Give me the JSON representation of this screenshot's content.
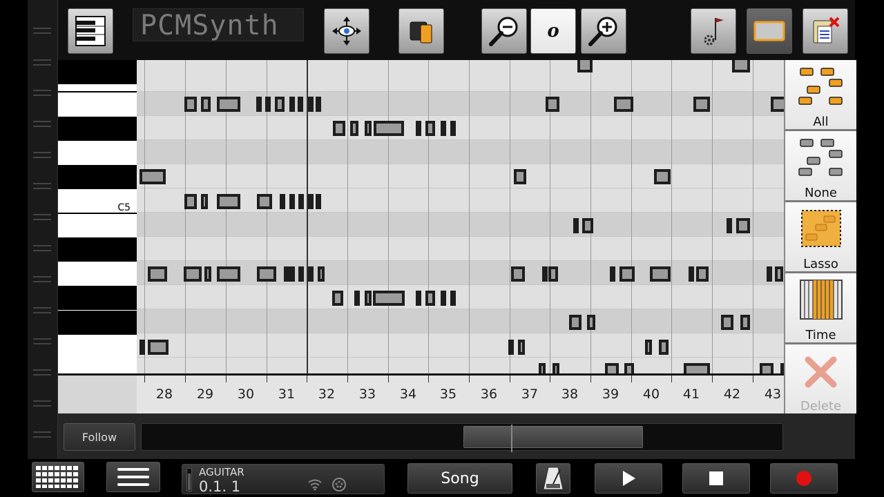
{
  "app": {
    "title_lcd": "PCMSynth",
    "accent_orange": "#f0a020",
    "record_red": "#e01010",
    "delete_red": "#e06040"
  },
  "toolbar": {
    "buttons": [
      {
        "name": "keyboard-mode-button",
        "icon": "piano-keys-icon"
      },
      {
        "name": "move-view-button",
        "icon": "move-eye-icon"
      },
      {
        "name": "copy-button",
        "icon": "copy-icon"
      },
      {
        "name": "zoom-out-button",
        "icon": "zoom-out-icon"
      },
      {
        "name": "note-length-button",
        "icon": "whole-note-icon",
        "label": "o"
      },
      {
        "name": "zoom-in-button",
        "icon": "zoom-in-icon"
      },
      {
        "name": "track-settings-button",
        "icon": "flag-gear-icon"
      },
      {
        "name": "select-rect-button",
        "icon": "orange-rect-icon"
      },
      {
        "name": "clipboard-clear-button",
        "icon": "clipboard-x-icon"
      }
    ]
  },
  "piano": {
    "c5_label": "C5"
  },
  "timeline": {
    "bars": [
      "28",
      "29",
      "30",
      "31",
      "32",
      "33",
      "34",
      "35",
      "36",
      "37",
      "38",
      "39",
      "40",
      "41",
      "42",
      "43"
    ]
  },
  "selection_panel": {
    "all_label": "All",
    "none_label": "None",
    "lasso_label": "Lasso",
    "time_label": "Time",
    "delete_label": "Delete"
  },
  "scroll": {
    "follow_label": "Follow",
    "thumb_position_fraction": 0.5,
    "thumb_size_fraction": 0.28
  },
  "transport": {
    "track_name": "AGUITAR",
    "track_position": "0.1. 1",
    "song_label": "Song"
  }
}
